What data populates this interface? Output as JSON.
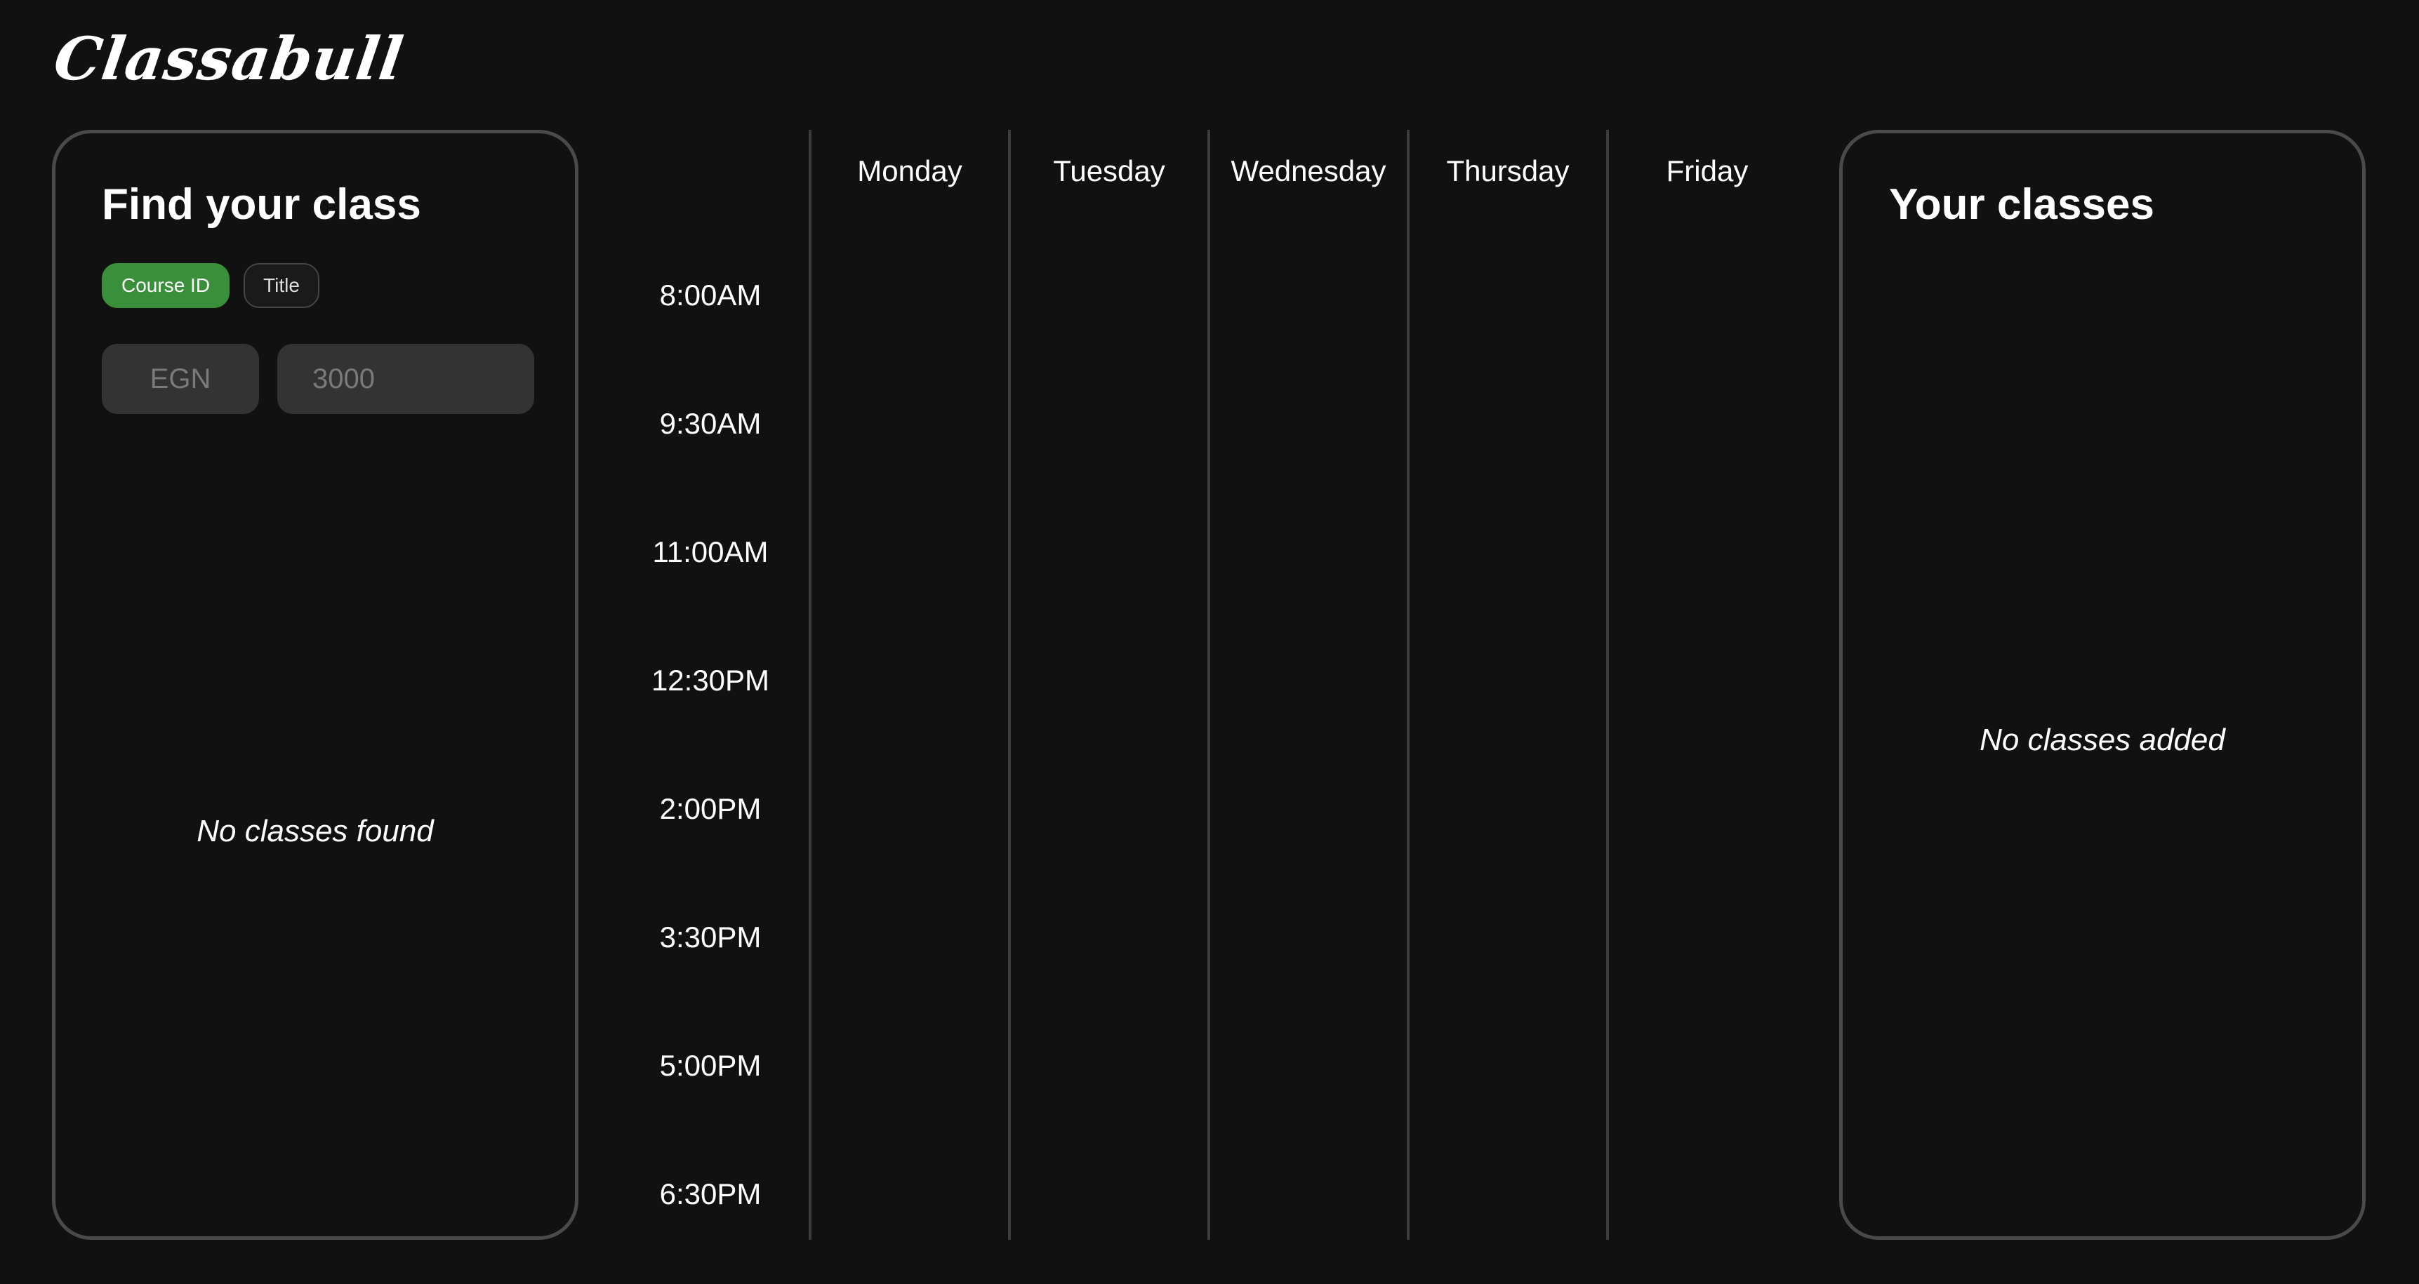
{
  "app": {
    "logo": "Classabull"
  },
  "search_panel": {
    "title": "Find your class",
    "toggles": [
      {
        "label": "Course ID",
        "active": true
      },
      {
        "label": "Title",
        "active": false
      }
    ],
    "dept_input": {
      "value": "",
      "placeholder": "EGN"
    },
    "number_input": {
      "value": "",
      "placeholder": "3000"
    },
    "empty_message": "No classes found"
  },
  "schedule": {
    "days": [
      "Monday",
      "Tuesday",
      "Wednesday",
      "Thursday",
      "Friday"
    ],
    "times": [
      "8:00AM",
      "9:30AM",
      "11:00AM",
      "12:30PM",
      "2:00PM",
      "3:30PM",
      "5:00PM",
      "6:30PM"
    ]
  },
  "classes_panel": {
    "title": "Your classes",
    "empty_message": "No classes added"
  },
  "colors": {
    "background": "#111111",
    "accent": "#3a8f3a",
    "border": "#4a4a4a",
    "input_bg": "#333333"
  }
}
